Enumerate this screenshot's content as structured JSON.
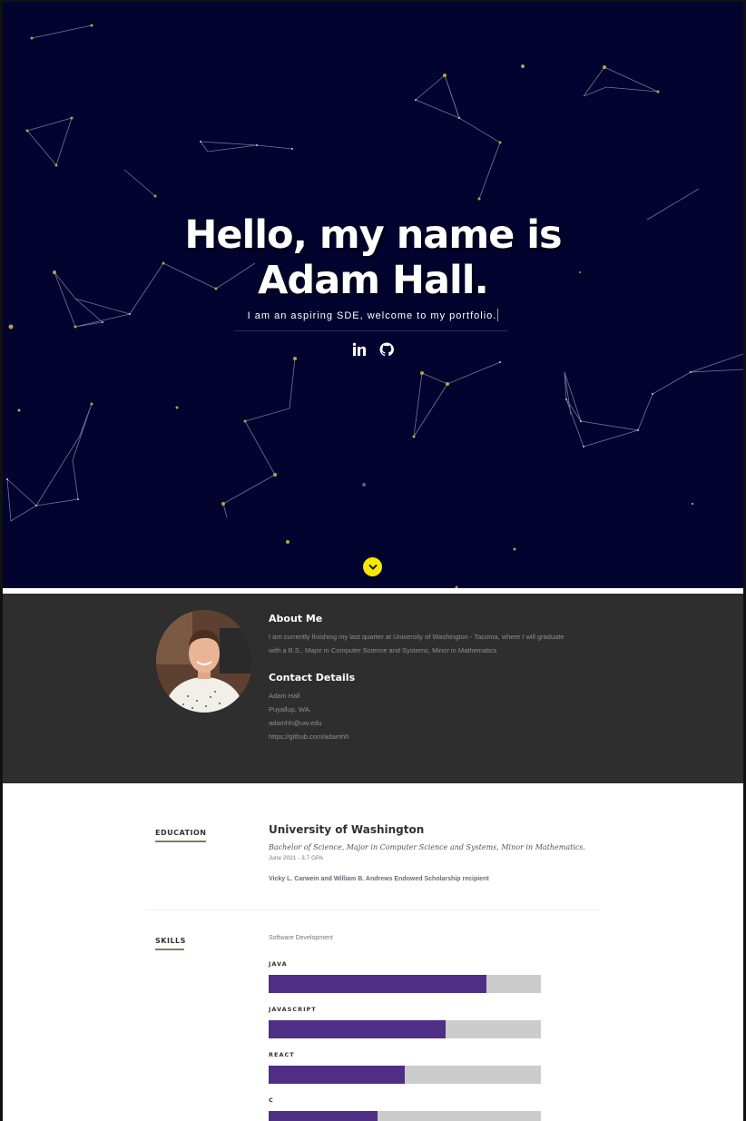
{
  "hero": {
    "title_line1": "Hello, my name is",
    "title_line2": "Adam Hall.",
    "subtitle": "I am an aspiring SDE, welcome to my portfolio.",
    "background_color": "#03032f",
    "social_icons": [
      "linkedin-icon",
      "github-icon"
    ],
    "scroll_icon": "chevron-down-icon",
    "scroll_button_color": "#f7e800"
  },
  "about": {
    "heading": "About Me",
    "bio_line1": "I am currently finishing my last quarter at University of Washington - Tacoma, where I will graduate",
    "bio_line2": "with a B.S., Major in Computer Science and Systems, Minor in Mathematics",
    "contact_heading": "Contact Details",
    "contact": [
      "Adam Hall",
      "Puyallup, WA.",
      "adamhh@uw.edu",
      "https://github.com/adamhh"
    ]
  },
  "education": {
    "label": "EDUCATION",
    "school": "University of Washington",
    "degree": "Bachelor of Science, Major in Computer Science and Systems, Minor in Mathematics.",
    "graduation": "June 2021 - 3.7 GPA",
    "award": "Vicky L. Carwein and William B. Andrews Endowed Scholarship recipient"
  },
  "skills": {
    "label": "SKILLS",
    "intro": "Software Development",
    "bar_color": "#4e2f85",
    "items": [
      {
        "name": "JAVA",
        "level": 0.8
      },
      {
        "name": "JAVASCRIPT",
        "level": 0.65
      },
      {
        "name": "REACT",
        "level": 0.5
      },
      {
        "name": "C",
        "level": 0.4
      }
    ]
  }
}
